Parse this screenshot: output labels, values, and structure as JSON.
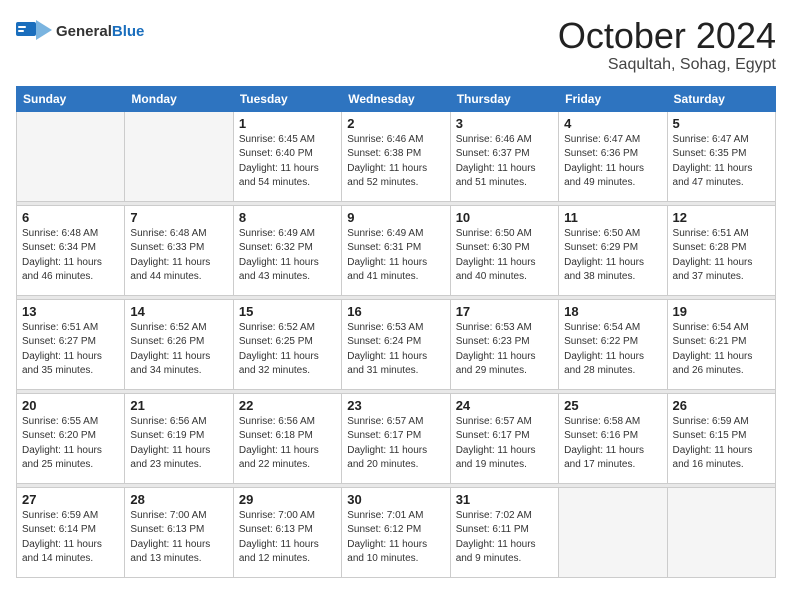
{
  "header": {
    "logo": {
      "text_general": "General",
      "text_blue": "Blue"
    },
    "title": "October 2024",
    "location": "Saqultah, Sohag, Egypt"
  },
  "days_of_week": [
    "Sunday",
    "Monday",
    "Tuesday",
    "Wednesday",
    "Thursday",
    "Friday",
    "Saturday"
  ],
  "weeks": [
    [
      {
        "day": "",
        "empty": true
      },
      {
        "day": "",
        "empty": true
      },
      {
        "day": "1",
        "sunrise": "6:45 AM",
        "sunset": "6:40 PM",
        "daylight": "11 hours and 54 minutes."
      },
      {
        "day": "2",
        "sunrise": "6:46 AM",
        "sunset": "6:38 PM",
        "daylight": "11 hours and 52 minutes."
      },
      {
        "day": "3",
        "sunrise": "6:46 AM",
        "sunset": "6:37 PM",
        "daylight": "11 hours and 51 minutes."
      },
      {
        "day": "4",
        "sunrise": "6:47 AM",
        "sunset": "6:36 PM",
        "daylight": "11 hours and 49 minutes."
      },
      {
        "day": "5",
        "sunrise": "6:47 AM",
        "sunset": "6:35 PM",
        "daylight": "11 hours and 47 minutes."
      }
    ],
    [
      {
        "day": "6",
        "sunrise": "6:48 AM",
        "sunset": "6:34 PM",
        "daylight": "11 hours and 46 minutes."
      },
      {
        "day": "7",
        "sunrise": "6:48 AM",
        "sunset": "6:33 PM",
        "daylight": "11 hours and 44 minutes."
      },
      {
        "day": "8",
        "sunrise": "6:49 AM",
        "sunset": "6:32 PM",
        "daylight": "11 hours and 43 minutes."
      },
      {
        "day": "9",
        "sunrise": "6:49 AM",
        "sunset": "6:31 PM",
        "daylight": "11 hours and 41 minutes."
      },
      {
        "day": "10",
        "sunrise": "6:50 AM",
        "sunset": "6:30 PM",
        "daylight": "11 hours and 40 minutes."
      },
      {
        "day": "11",
        "sunrise": "6:50 AM",
        "sunset": "6:29 PM",
        "daylight": "11 hours and 38 minutes."
      },
      {
        "day": "12",
        "sunrise": "6:51 AM",
        "sunset": "6:28 PM",
        "daylight": "11 hours and 37 minutes."
      }
    ],
    [
      {
        "day": "13",
        "sunrise": "6:51 AM",
        "sunset": "6:27 PM",
        "daylight": "11 hours and 35 minutes."
      },
      {
        "day": "14",
        "sunrise": "6:52 AM",
        "sunset": "6:26 PM",
        "daylight": "11 hours and 34 minutes."
      },
      {
        "day": "15",
        "sunrise": "6:52 AM",
        "sunset": "6:25 PM",
        "daylight": "11 hours and 32 minutes."
      },
      {
        "day": "16",
        "sunrise": "6:53 AM",
        "sunset": "6:24 PM",
        "daylight": "11 hours and 31 minutes."
      },
      {
        "day": "17",
        "sunrise": "6:53 AM",
        "sunset": "6:23 PM",
        "daylight": "11 hours and 29 minutes."
      },
      {
        "day": "18",
        "sunrise": "6:54 AM",
        "sunset": "6:22 PM",
        "daylight": "11 hours and 28 minutes."
      },
      {
        "day": "19",
        "sunrise": "6:54 AM",
        "sunset": "6:21 PM",
        "daylight": "11 hours and 26 minutes."
      }
    ],
    [
      {
        "day": "20",
        "sunrise": "6:55 AM",
        "sunset": "6:20 PM",
        "daylight": "11 hours and 25 minutes."
      },
      {
        "day": "21",
        "sunrise": "6:56 AM",
        "sunset": "6:19 PM",
        "daylight": "11 hours and 23 minutes."
      },
      {
        "day": "22",
        "sunrise": "6:56 AM",
        "sunset": "6:18 PM",
        "daylight": "11 hours and 22 minutes."
      },
      {
        "day": "23",
        "sunrise": "6:57 AM",
        "sunset": "6:17 PM",
        "daylight": "11 hours and 20 minutes."
      },
      {
        "day": "24",
        "sunrise": "6:57 AM",
        "sunset": "6:17 PM",
        "daylight": "11 hours and 19 minutes."
      },
      {
        "day": "25",
        "sunrise": "6:58 AM",
        "sunset": "6:16 PM",
        "daylight": "11 hours and 17 minutes."
      },
      {
        "day": "26",
        "sunrise": "6:59 AM",
        "sunset": "6:15 PM",
        "daylight": "11 hours and 16 minutes."
      }
    ],
    [
      {
        "day": "27",
        "sunrise": "6:59 AM",
        "sunset": "6:14 PM",
        "daylight": "11 hours and 14 minutes."
      },
      {
        "day": "28",
        "sunrise": "7:00 AM",
        "sunset": "6:13 PM",
        "daylight": "11 hours and 13 minutes."
      },
      {
        "day": "29",
        "sunrise": "7:00 AM",
        "sunset": "6:13 PM",
        "daylight": "11 hours and 12 minutes."
      },
      {
        "day": "30",
        "sunrise": "7:01 AM",
        "sunset": "6:12 PM",
        "daylight": "11 hours and 10 minutes."
      },
      {
        "day": "31",
        "sunrise": "7:02 AM",
        "sunset": "6:11 PM",
        "daylight": "11 hours and 9 minutes."
      },
      {
        "day": "",
        "empty": true
      },
      {
        "day": "",
        "empty": true
      }
    ]
  ]
}
